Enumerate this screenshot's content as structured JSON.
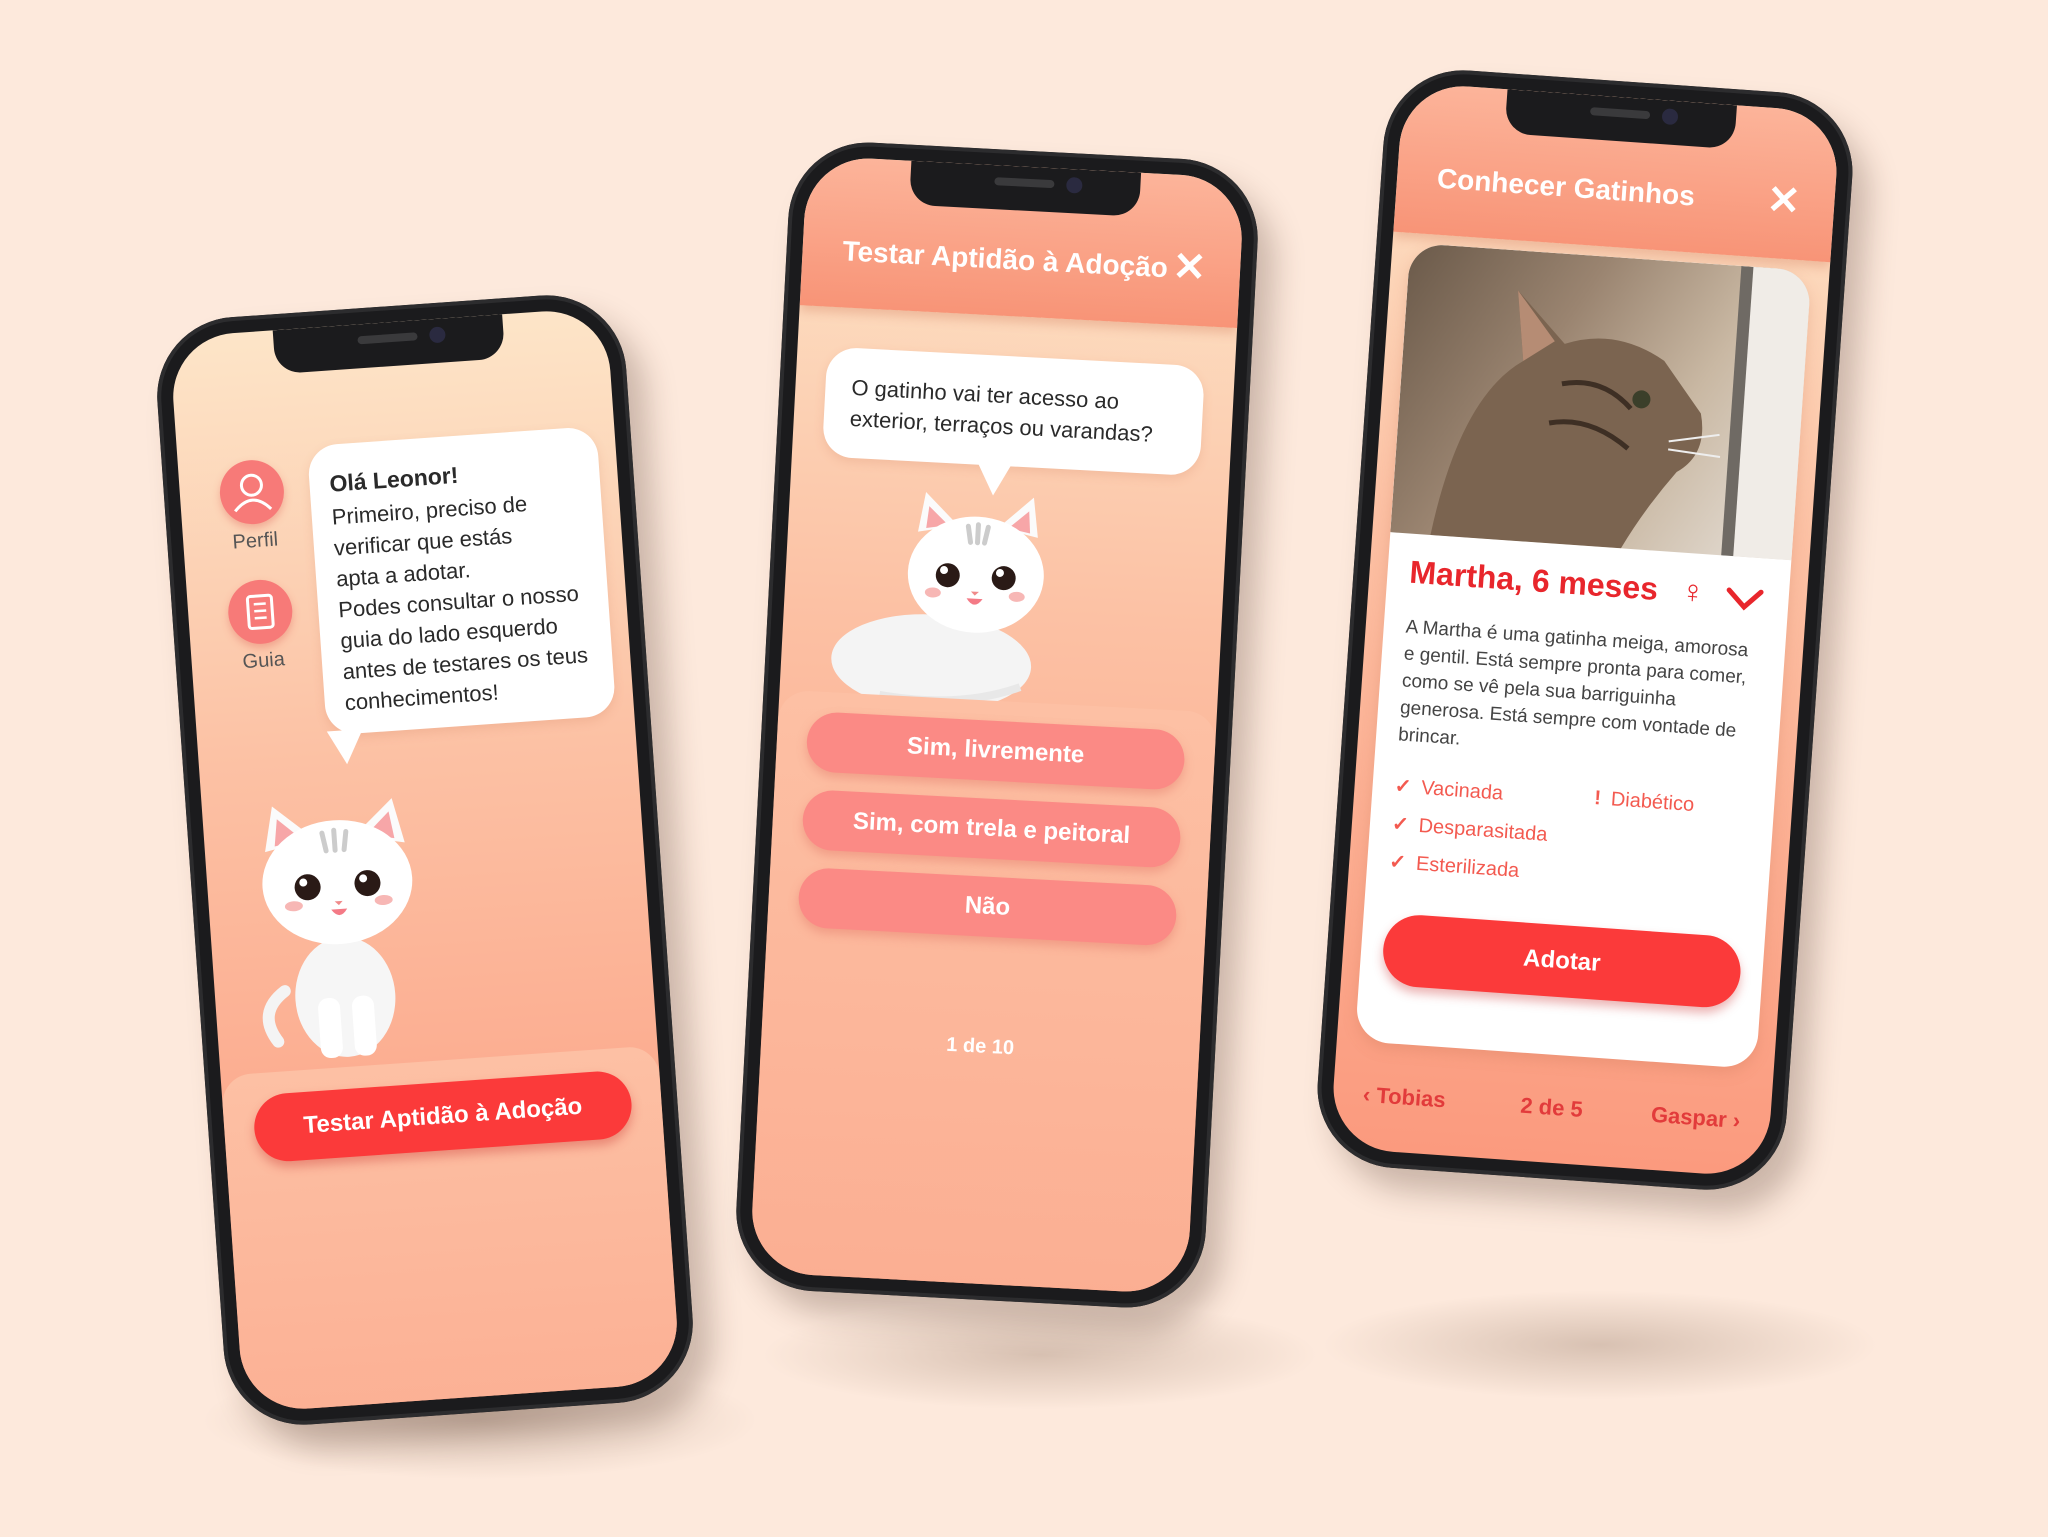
{
  "colors": {
    "background": "#fde9dc",
    "accent": "#fb3a3a",
    "answer": "#fb8a85",
    "header": "#f89477",
    "icon_circle": "#f77a78"
  },
  "screen1": {
    "sidebar": [
      {
        "label": "Perfil",
        "icon": "profile-icon"
      },
      {
        "label": "Guia",
        "icon": "book-icon"
      }
    ],
    "greeting": "Olá Leonor!",
    "message_lines": [
      "Primeiro, preciso de",
      "verificar que estás",
      "apta a adotar.",
      "Podes consultar o nosso",
      "guia do lado esquerdo",
      "antes de testares os teus",
      "conhecimentos!"
    ],
    "cta_label": "Testar Aptidão à Adoção"
  },
  "screen2": {
    "title": "Testar Aptidão à Adoção",
    "close": "✕",
    "question_lines": [
      "O gatinho vai ter acesso ao",
      "exterior, terraços ou varandas?"
    ],
    "answers": [
      "Sim, livremente",
      "Sim, com trela e peitoral",
      "Não"
    ],
    "progress": "1 de 10"
  },
  "screen3": {
    "title": "Conhecer Gatinhos",
    "close": "✕",
    "cat_name": "Martha, 6 meses",
    "gender_symbol": "♀",
    "description_lines": [
      "A Martha é uma gatinha meiga, amorosa",
      "e gentil. Está sempre pronta para comer,",
      "como se vê pela sua barriguinha",
      "generosa. Está sempre com vontade de",
      "brincar."
    ],
    "traits": [
      "Vacinada",
      "Desparasitada",
      "Esterilizada"
    ],
    "warning_mark": "!",
    "warning": "Diabético",
    "adopt_label": "Adotar",
    "prev_label": "Tobias",
    "pager": "2 de 5",
    "next_label": "Gaspar"
  }
}
